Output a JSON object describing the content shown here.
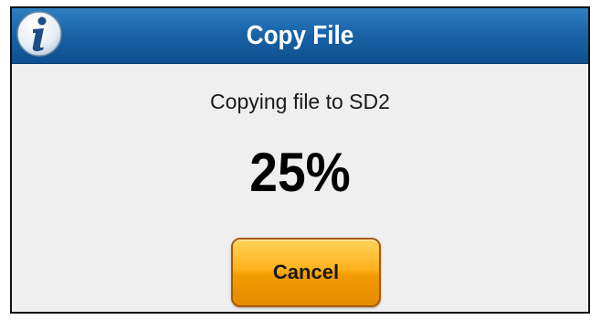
{
  "dialog": {
    "title": "Copy File",
    "icon": "info-icon",
    "message": "Copying file to SD2",
    "progress_text": "25%",
    "progress": 0.25,
    "cancel_label": "Cancel"
  },
  "colors": {
    "title_bar": "#1a64a8",
    "button": "#ffb21e",
    "background": "#efefef"
  }
}
